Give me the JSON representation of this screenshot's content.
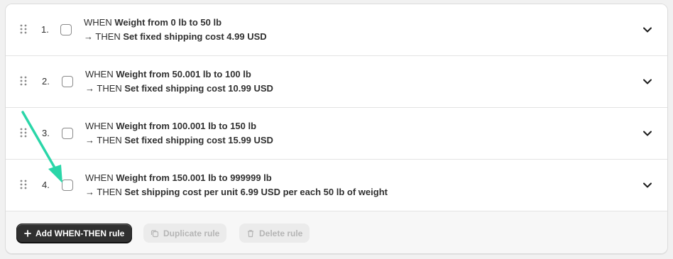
{
  "rules": [
    {
      "number": "1.",
      "when_prefix": "WHEN",
      "when": "Weight from 0 lb to 50 lb",
      "then_prefix": "→ THEN",
      "then": "Set fixed shipping cost 4.99 USD",
      "checked": false
    },
    {
      "number": "2.",
      "when_prefix": "WHEN",
      "when": "Weight from 50.001 lb to 100 lb",
      "then_prefix": "→ THEN",
      "then": "Set fixed shipping cost 10.99 USD",
      "checked": false
    },
    {
      "number": "3.",
      "when_prefix": "WHEN",
      "when": "Weight from 100.001 lb to 150 lb",
      "then_prefix": "→ THEN",
      "then": "Set fixed shipping cost 15.99 USD",
      "checked": false
    },
    {
      "number": "4.",
      "when_prefix": "WHEN",
      "when": "Weight from 150.001 lb to 999999 lb",
      "then_prefix": "→ THEN",
      "then": "Set shipping cost per unit 6.99 USD per each 50 lb of weight",
      "checked": false
    }
  ],
  "footer": {
    "add_label": "Add WHEN-THEN rule",
    "duplicate_label": "Duplicate rule",
    "delete_label": "Delete rule"
  },
  "icons": {
    "drag": "drag-handle-icon",
    "chevron": "chevron-down-icon",
    "plus": "plus-icon",
    "duplicate": "duplicate-icon",
    "delete": "trash-icon"
  },
  "colors": {
    "primary_button": "#303030",
    "annotation_arrow": "#2ad6a8"
  }
}
